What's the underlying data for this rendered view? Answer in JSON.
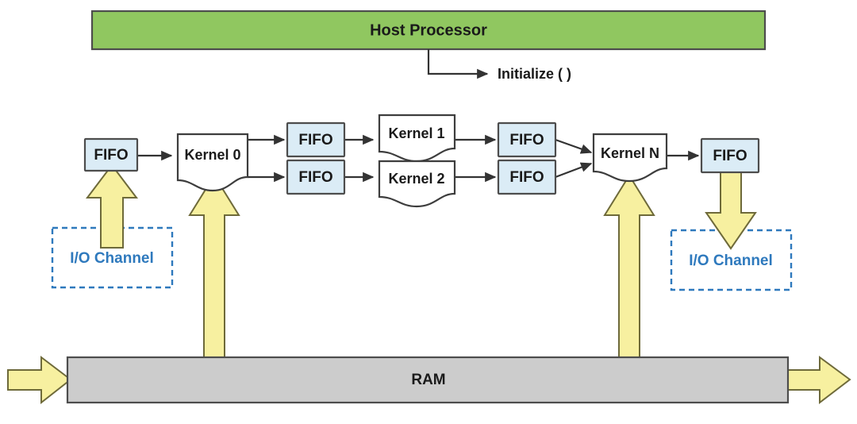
{
  "diagram": {
    "title": "Dataflow kernel pipeline block diagram",
    "colors": {
      "host_fill": "#90c760",
      "fifo_fill": "#dbecf6",
      "kernel_fill": "#ffffff",
      "ram_fill": "#cccccc",
      "arrow_fill": "#f7f0a0",
      "io_channel_stroke": "#2e79bd",
      "box_stroke": "#4d4d4d",
      "connector_stroke": "#333333"
    },
    "host": {
      "label": "Host Processor"
    },
    "initialize": {
      "label": "Initialize ( )"
    },
    "ram": {
      "label": "RAM"
    },
    "io_channels": [
      {
        "id": "io-channel-left",
        "label": "I/O Channel"
      },
      {
        "id": "io-channel-right",
        "label": "I/O Channel"
      }
    ],
    "fifos": [
      {
        "id": "fifo-input",
        "label": "FIFO"
      },
      {
        "id": "fifo-k0-top",
        "label": "FIFO"
      },
      {
        "id": "fifo-k0-bottom",
        "label": "FIFO"
      },
      {
        "id": "fifo-k1-out",
        "label": "FIFO"
      },
      {
        "id": "fifo-k2-out",
        "label": "FIFO"
      },
      {
        "id": "fifo-output",
        "label": "FIFO"
      }
    ],
    "kernels": [
      {
        "id": "kernel-0",
        "label": "Kernel 0"
      },
      {
        "id": "kernel-1",
        "label": "Kernel 1"
      },
      {
        "id": "kernel-2",
        "label": "Kernel 2"
      },
      {
        "id": "kernel-n",
        "label": "Kernel N"
      }
    ],
    "icons": {
      "up_arrow": "arrow-up-icon",
      "down_arrow": "arrow-down-icon",
      "right_arrow": "arrow-right-icon",
      "flow_arrow": "flow-arrowhead-icon"
    }
  }
}
